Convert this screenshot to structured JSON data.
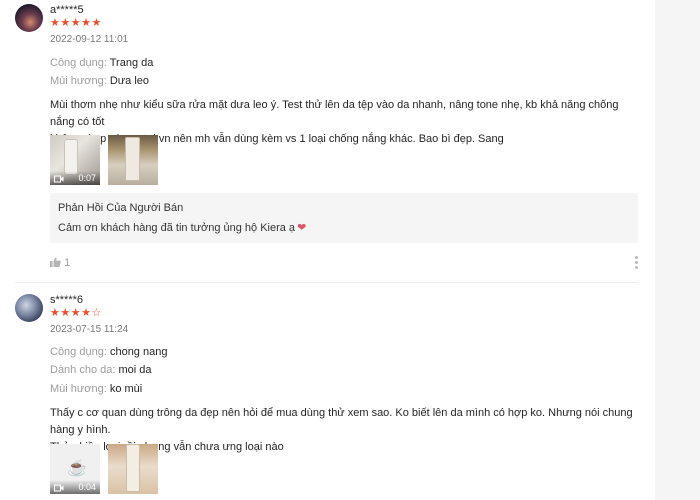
{
  "reviews": [
    {
      "username": "a*****5",
      "stars_filled": "★★★★★",
      "stars_empty": "",
      "rating": 5,
      "time": "2022-09-12 11:01",
      "attributes": [
        {
          "key": "Công dụng:",
          "value": "Trang da"
        },
        {
          "key": "Mùi hương:",
          "value": "Dưa leo"
        }
      ],
      "comment_lines": [
        "Mùi thơm nhẹ như kiểu sữa rửa mặt dưa leo ý. Test thử lên da tệp vào da nhanh, nâng tone nhẹ, kb khả năng chống nắng có tốt",
        "không vì sp này sx tại vn nên mh vẫn dùng kèm vs 1 loại chống nắng khác. Bao bì đẹp. Sang"
      ],
      "video_duration": "0:07",
      "seller_reply": {
        "title": "Phản Hồi Của Người Bán",
        "message": "Cảm ơn khách hàng đã tin tưởng ủng hộ Kiera ạ"
      },
      "likes": "1"
    },
    {
      "username": "s*****6",
      "stars_filled": "★★★★",
      "stars_empty": "☆",
      "rating": 4,
      "time": "2023-07-15 11:24",
      "attributes": [
        {
          "key": "Công dụng:",
          "value": "chong nang"
        },
        {
          "key": "Dành cho da:",
          "value": "moi da"
        },
        {
          "key": "Mùi hương:",
          "value": "ko mùi"
        }
      ],
      "comment_lines": [
        "Thấy c cơ quan dùng trông da đẹp nên hỏi để mua dùng thử xem sao. Ko biết lên da mình có hợp ko. Nhưng nói chung hàng y hình.",
        "Thử nhiều loại rồi nhưng vẫn chưa ưng loại nào"
      ],
      "video_duration": "0:04"
    }
  ],
  "colors": {
    "accent": "#ee4d2d",
    "muted": "#999999",
    "seller_bg": "#f5f5f5",
    "heart": "#e0556a"
  },
  "icons": [
    "video-camera-icon",
    "thumbs-up-icon",
    "more-vertical-icon",
    "heart-icon",
    "cup-icon"
  ]
}
